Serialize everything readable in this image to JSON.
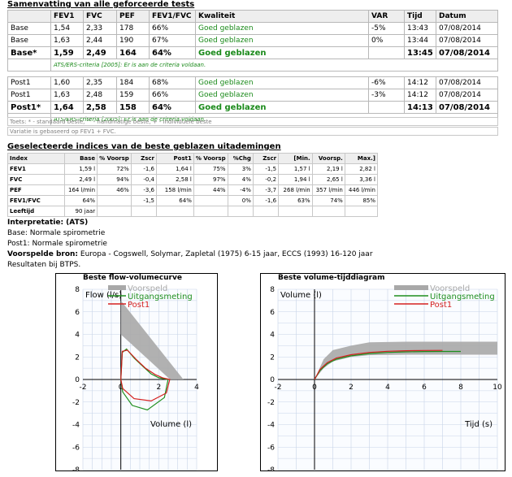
{
  "summary": {
    "title": "Samenvatting van alle geforceerde tests",
    "headers": [
      "",
      "FEV1",
      "FVC",
      "PEF",
      "FEV1/FVC",
      "Kwaliteit",
      "VAR",
      "Tijd",
      "Datum"
    ],
    "rows": [
      {
        "label": "Base",
        "fev1": "1,54",
        "fvc": "2,33",
        "pef": "178",
        "ratio": "66%",
        "quality": "Goed geblazen",
        "var": "-5%",
        "time": "13:43",
        "date": "07/08/2014"
      },
      {
        "label": "Base",
        "fev1": "1,63",
        "fvc": "2,44",
        "pef": "190",
        "ratio": "67%",
        "quality": "Goed geblazen",
        "var": "0%",
        "time": "13:44",
        "date": "07/08/2014"
      },
      {
        "label": "Base*",
        "fev1": "1,59",
        "fvc": "2,49",
        "pef": "164",
        "ratio": "64%",
        "quality": "Goed geblazen",
        "var": "",
        "time": "13:45",
        "date": "07/08/2014"
      },
      {
        "label": "Post1",
        "fev1": "1,60",
        "fvc": "2,35",
        "pef": "184",
        "ratio": "68%",
        "quality": "Goed geblazen",
        "var": "-6%",
        "time": "14:12",
        "date": "07/08/2014"
      },
      {
        "label": "Post1",
        "fev1": "1,63",
        "fvc": "2,48",
        "pef": "159",
        "ratio": "66%",
        "quality": "Goed geblazen",
        "var": "-3%",
        "time": "14:12",
        "date": "07/08/2014"
      },
      {
        "label": "Post1*",
        "fev1": "1,64",
        "fvc": "2,58",
        "pef": "158",
        "ratio": "64%",
        "quality": "Goed geblazen",
        "var": "",
        "time": "14:13",
        "date": "07/08/2014"
      }
    ],
    "criteria_note": "ATS/ERS-criteria [2005]: Er is aan de criteria voldaan.",
    "footnote_1": "Toets: * - standaard beste, ^ - handmatige beste, + - individuele beste",
    "footnote_2": "Variatie is gebaseerd op FEV1 + FVC."
  },
  "indices": {
    "title": "Geselecteerde indices van de beste geblazen uitademingen",
    "headers": [
      "Index",
      "Base",
      "% Voorsp",
      "Zscr",
      "Post1",
      "% Voorsp",
      "%Chg",
      "Zscr",
      "[Min.",
      "Voorsp.",
      "Max.]"
    ],
    "rows": [
      [
        "FEV1",
        "1,59 l",
        "72%",
        "-1,6",
        "1,64 l",
        "75%",
        "3%",
        "-1,5",
        "1,57 l",
        "2,19 l",
        "2,82 l"
      ],
      [
        "FVC",
        "2,49 l",
        "94%",
        "-0,4",
        "2,58 l",
        "97%",
        "4%",
        "-0,2",
        "1,94 l",
        "2,65 l",
        "3,36 l"
      ],
      [
        "PEF",
        "164 l/min",
        "46%",
        "-3,6",
        "158 l/min",
        "44%",
        "-4%",
        "-3,7",
        "268 l/min",
        "357 l/min",
        "446 l/min"
      ],
      [
        "FEV1/FVC",
        "64%",
        "",
        "-1,5",
        "64%",
        "",
        "0%",
        "-1,6",
        "63%",
        "74%",
        "85%"
      ],
      [
        "Leeftijd",
        "90 jaar",
        "",
        "",
        "",
        "",
        "",
        "",
        "",
        "",
        ""
      ]
    ]
  },
  "interpretation": {
    "title": "Interpretatie: (ATS)",
    "line1": "Base: Normale spirometrie",
    "line2": "Post1: Normale spirometrie",
    "source_label": "Voorspelde bron:",
    "source_text": "Europa - Cogswell, Solymar, Zapletal (1975) 6-15 jaar, ECCS (1993) 16-120 jaar",
    "btps": "Resultaten bij BTPS."
  },
  "colors": {
    "predicted": "#a8a8a8",
    "baseline": "#1f8f1f",
    "post": "#d42020",
    "grid": "#c8d4e8"
  },
  "chart_data": [
    {
      "type": "line",
      "title": "Beste flow-volumecurve",
      "xlabel": "Volume (l)",
      "ylabel": "Flow (l/s)",
      "xlim": [
        -2,
        4
      ],
      "ylim": [
        -8,
        8
      ],
      "xticks": [
        "-2",
        "",
        "2",
        "4"
      ],
      "xticks_numeric": [
        -2,
        0,
        2,
        4
      ],
      "x_tick_labels": [
        "-2",
        "0",
        "2",
        "4"
      ],
      "y_tick_labels": [
        "8",
        "6",
        "4",
        "2",
        "0",
        "-2",
        "-4",
        "-6",
        "-8"
      ],
      "grid": true,
      "legend": [
        "Voorspeld",
        "Uitgangsmeting",
        "Post1"
      ],
      "predicted_area": [
        [
          0,
          7
        ],
        [
          0,
          4
        ],
        [
          2.6,
          0
        ],
        [
          3.3,
          0
        ]
      ],
      "series": [
        {
          "name": "Uitgangsmeting",
          "points": [
            [
              0,
              0
            ],
            [
              0.08,
              2.4
            ],
            [
              0.3,
              2.7
            ],
            [
              0.7,
              1.9
            ],
            [
              1.2,
              1.1
            ],
            [
              1.6,
              0.5
            ],
            [
              2.0,
              0.15
            ],
            [
              2.49,
              0
            ],
            [
              2.3,
              -1.6
            ],
            [
              1.4,
              -2.7
            ],
            [
              0.6,
              -2.3
            ],
            [
              0.1,
              -1.1
            ],
            [
              0,
              0
            ]
          ]
        },
        {
          "name": "Post1",
          "points": [
            [
              0,
              0
            ],
            [
              0.08,
              2.5
            ],
            [
              0.35,
              2.6
            ],
            [
              0.8,
              1.8
            ],
            [
              1.3,
              1.0
            ],
            [
              1.8,
              0.45
            ],
            [
              2.2,
              0.15
            ],
            [
              2.58,
              0
            ],
            [
              2.4,
              -1.2
            ],
            [
              1.6,
              -1.9
            ],
            [
              0.7,
              -1.7
            ],
            [
              0.1,
              -0.8
            ],
            [
              0,
              0
            ]
          ]
        }
      ]
    },
    {
      "type": "line",
      "title": "Beste volume-tijddiagram",
      "xlabel": "Tijd (s)",
      "ylabel": "Volume (l)",
      "xlim": [
        -2,
        10
      ],
      "ylim": [
        -8,
        8
      ],
      "x_tick_labels": [
        "-2",
        "0",
        "2",
        "4",
        "6",
        "8",
        "10"
      ],
      "y_tick_labels": [
        "8",
        "6",
        "4",
        "2",
        "0",
        "-2",
        "-4",
        "-6",
        "-8"
      ],
      "grid": true,
      "legend": [
        "Voorspeld",
        "Uitgangsmeting",
        "Post1"
      ],
      "predicted_band": [
        [
          0,
          0,
          0
        ],
        [
          0.5,
          1.0,
          1.8
        ],
        [
          1,
          1.6,
          2.6
        ],
        [
          2,
          2.0,
          3.0
        ],
        [
          3,
          2.15,
          3.3
        ],
        [
          5,
          2.2,
          3.35
        ],
        [
          8,
          2.2,
          3.35
        ],
        [
          10,
          2.2,
          3.35
        ]
      ],
      "series": [
        {
          "name": "Uitgangsmeting",
          "points": [
            [
              0,
              0
            ],
            [
              0.3,
              0.8
            ],
            [
              0.7,
              1.4
            ],
            [
              1.2,
              1.8
            ],
            [
              2,
              2.1
            ],
            [
              3,
              2.3
            ],
            [
              4,
              2.4
            ],
            [
              5,
              2.45
            ],
            [
              6,
              2.48
            ],
            [
              7,
              2.49
            ],
            [
              8,
              2.49
            ]
          ]
        },
        {
          "name": "Post1",
          "points": [
            [
              0,
              0
            ],
            [
              0.3,
              0.9
            ],
            [
              0.7,
              1.5
            ],
            [
              1.2,
              1.9
            ],
            [
              2,
              2.2
            ],
            [
              3,
              2.4
            ],
            [
              4,
              2.5
            ],
            [
              5,
              2.55
            ],
            [
              6,
              2.57
            ],
            [
              7,
              2.58
            ]
          ]
        }
      ]
    }
  ]
}
